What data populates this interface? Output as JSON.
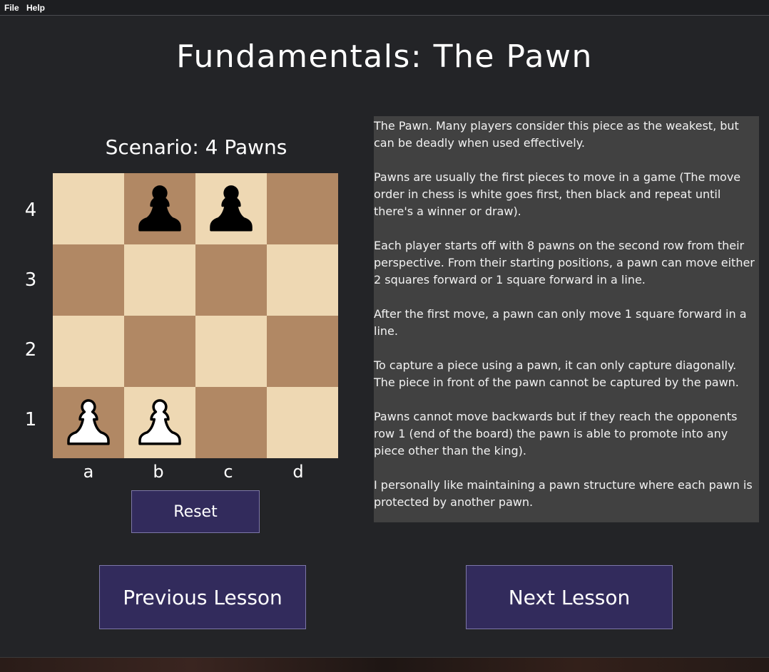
{
  "menu": {
    "file_label": "File",
    "help_label": "Help"
  },
  "page_title": "Fundamentals: The Pawn",
  "scenario_title": "Scenario: 4 Pawns",
  "board": {
    "ranks": [
      "4",
      "3",
      "2",
      "1"
    ],
    "files": [
      "a",
      "b",
      "c",
      "d"
    ],
    "squares": [
      [
        "",
        "black-pawn",
        "black-pawn",
        ""
      ],
      [
        "",
        "",
        "",
        ""
      ],
      [
        "",
        "",
        "",
        ""
      ],
      [
        "white-pawn",
        "white-pawn",
        "",
        ""
      ]
    ],
    "light_color": "#eed8b3",
    "dark_color": "#b18864"
  },
  "buttons": {
    "reset_label": "Reset",
    "previous_label": "Previous Lesson",
    "next_label": "Next Lesson",
    "color": "#322b5c"
  },
  "lesson_text": [
    "The Pawn. Many players consider this piece as the weakest, but can be deadly when used effectively.",
    "Pawns are usually the first pieces to move in a game (The move order in chess is white goes first, then black and repeat until there's a winner or draw).",
    "Each player starts off with 8 pawns on the second row from their perspective. From their starting positions, a pawn can move either 2 squares forward or 1 square forward in a line.",
    "After the first move, a pawn can only move 1 square forward in a line.",
    "To capture a piece using a pawn, it can only capture diagonally. The piece in front of the pawn cannot be captured by the pawn.",
    "Pawns cannot move backwards but if they reach the opponents row 1 (end of the board) the pawn is able to promote into any piece other than the king).",
    "I personally like maintaining a pawn structure where each pawn is protected by another pawn."
  ]
}
